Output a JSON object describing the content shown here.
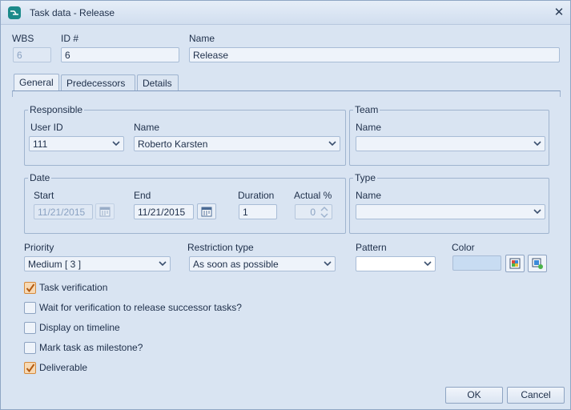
{
  "window": {
    "title": "Task data - Release",
    "close_symbol": "✕"
  },
  "header": {
    "wbs_label": "WBS",
    "wbs_value": "6",
    "id_label": "ID #",
    "id_value": "6",
    "name_label": "Name",
    "name_value": "Release"
  },
  "tabs": [
    {
      "label": "General",
      "active": true
    },
    {
      "label": "Predecessors",
      "active": false
    },
    {
      "label": "Details",
      "active": false
    }
  ],
  "responsible": {
    "title": "Responsible",
    "user_id_label": "User ID",
    "user_id_value": "111",
    "name_label": "Name",
    "name_value": "Roberto Karsten"
  },
  "team": {
    "title": "Team",
    "name_label": "Name",
    "name_value": ""
  },
  "date": {
    "title": "Date",
    "start_label": "Start",
    "start_value": "11/21/2015",
    "end_label": "End",
    "end_value": "11/21/2015",
    "duration_label": "Duration",
    "duration_value": "1",
    "actual_label": "Actual %",
    "actual_value": "0"
  },
  "type": {
    "title": "Type",
    "name_label": "Name",
    "name_value": ""
  },
  "priority": {
    "label": "Priority",
    "value": "Medium [ 3 ]"
  },
  "restriction": {
    "label": "Restriction type",
    "value": "As soon as possible"
  },
  "pattern": {
    "label": "Pattern",
    "value": ""
  },
  "color": {
    "label": "Color",
    "value_hex": "#c8dcf2"
  },
  "checkboxes": [
    {
      "label": "Task verification",
      "checked": true
    },
    {
      "label": "Wait for verification to release successor tasks?",
      "checked": false
    },
    {
      "label": "Display on timeline",
      "checked": false
    },
    {
      "label": "Mark task as milestone?",
      "checked": false
    },
    {
      "label": "Deliverable",
      "checked": true
    }
  ],
  "buttons": {
    "ok": "OK",
    "cancel": "Cancel"
  },
  "icons": {
    "app": "task-app-icon",
    "calendar": "calendar-icon",
    "dropdown": "chevron-down-icon",
    "spinner": "spinner-arrows-icon",
    "color_pick": "color-picker-icon",
    "color_clear": "color-reset-icon",
    "check": "checkmark-icon"
  },
  "colors": {
    "accent": "#d58a3c",
    "window_bg": "#d9e4f2",
    "border": "#9fb4cf"
  }
}
